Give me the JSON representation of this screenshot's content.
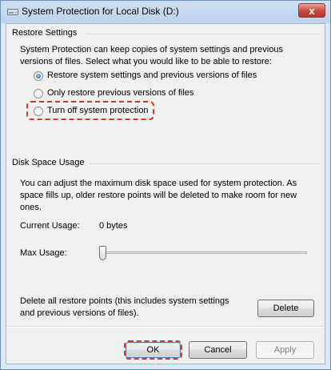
{
  "window": {
    "title": "System Protection for Local Disk (D:)",
    "close_label": "x"
  },
  "restore_settings": {
    "heading": "Restore Settings",
    "description_line1": "System Protection can keep copies of system settings and previous",
    "description_line2": "versions of files. Select what you would like to be able to restore:",
    "options": [
      {
        "label": "Restore system settings and previous versions of files",
        "checked": true
      },
      {
        "label": "Only restore previous versions of files",
        "checked": false
      },
      {
        "label": "Turn off system protection",
        "checked": false
      }
    ]
  },
  "disk_space": {
    "heading": "Disk Space Usage",
    "description_line1": "You can adjust the maximum disk space used for system protection. As",
    "description_line2": "space fills up, older restore points will be deleted to make room for new",
    "description_line3": "ones.",
    "current_usage_label": "Current Usage:",
    "current_usage_value": "0 bytes",
    "max_usage_label": "Max Usage:",
    "max_usage_fraction": 0
  },
  "delete_section": {
    "text_line1": "Delete all restore points (this includes system settings",
    "text_line2": "and previous versions of files).",
    "delete_label": "Delete"
  },
  "footer": {
    "ok_label": "OK",
    "cancel_label": "Cancel",
    "apply_label": "Apply"
  },
  "colors": {
    "highlight": "#d9352b",
    "radio_selected": "#1c5fa8"
  }
}
